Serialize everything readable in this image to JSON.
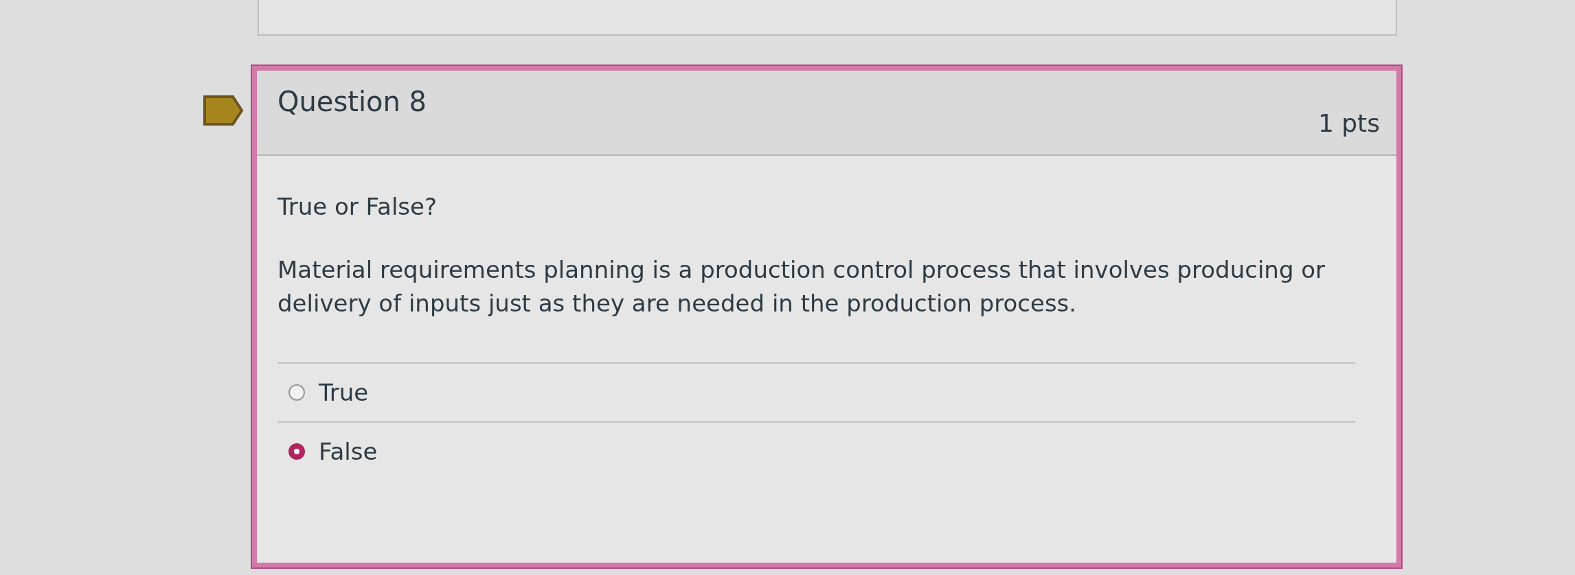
{
  "question": {
    "title": "Question 8",
    "points": "1 pts",
    "prompt": "True or False?",
    "text": "Material requirements planning is a production control process that involves producing or delivery of inputs just as they are needed in the production process.",
    "answers": [
      {
        "label": "True",
        "selected": false
      },
      {
        "label": "False",
        "selected": true
      }
    ]
  }
}
